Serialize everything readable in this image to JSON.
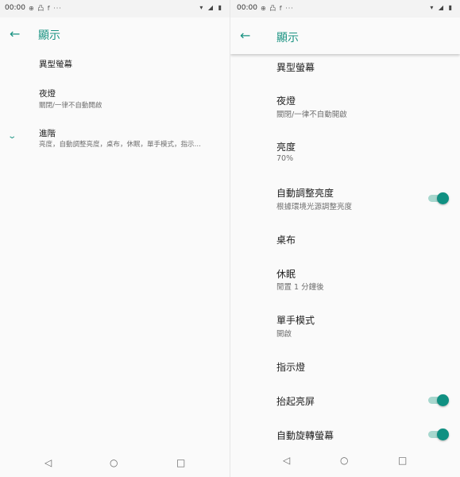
{
  "status_bar": {
    "time": "00:00",
    "left_icons": [
      "globe-icon",
      "thumbs-up-icon",
      "facebook-icon",
      "more-icon"
    ],
    "right_icons": [
      "wifi-icon",
      "signal-icon",
      "battery-icon"
    ],
    "left_icons_glyphs": "⊕ 凸 f ···",
    "right_icons_glyphs": "▾ ◢ ▮"
  },
  "colors": {
    "accent": "#1a9382",
    "toggle_thumb": "#109082",
    "toggle_track": "#a7d7ce"
  },
  "left": {
    "header": {
      "title": "顯示"
    },
    "items": [
      {
        "title": "異型螢幕"
      },
      {
        "title": "夜燈",
        "subtitle": "關閉/一律不自動開啟"
      },
      {
        "title": "進階",
        "subtitle": "亮度，自動調整亮度，桌布，休眠，單手模式，指示…"
      }
    ]
  },
  "right": {
    "header": {
      "title": "顯示"
    },
    "items": [
      {
        "title": "異型螢幕"
      },
      {
        "title": "夜燈",
        "subtitle": "關閉/一律不自動開啟"
      },
      {
        "title": "亮度",
        "subtitle": "70%"
      },
      {
        "title": "自動調整亮度",
        "subtitle": "根據環境光源調整亮度",
        "toggle": "on"
      },
      {
        "title": "桌布"
      },
      {
        "title": "休眠",
        "subtitle": "閒置 1 分鐘後"
      },
      {
        "title": "單手模式",
        "subtitle": "開啟"
      },
      {
        "title": "指示燈"
      },
      {
        "title": "抬起亮屏",
        "toggle": "on"
      },
      {
        "title": "自動旋轉螢幕",
        "toggle": "on"
      }
    ]
  },
  "nav": {
    "back": "◁",
    "home": "○",
    "recents": "□"
  }
}
